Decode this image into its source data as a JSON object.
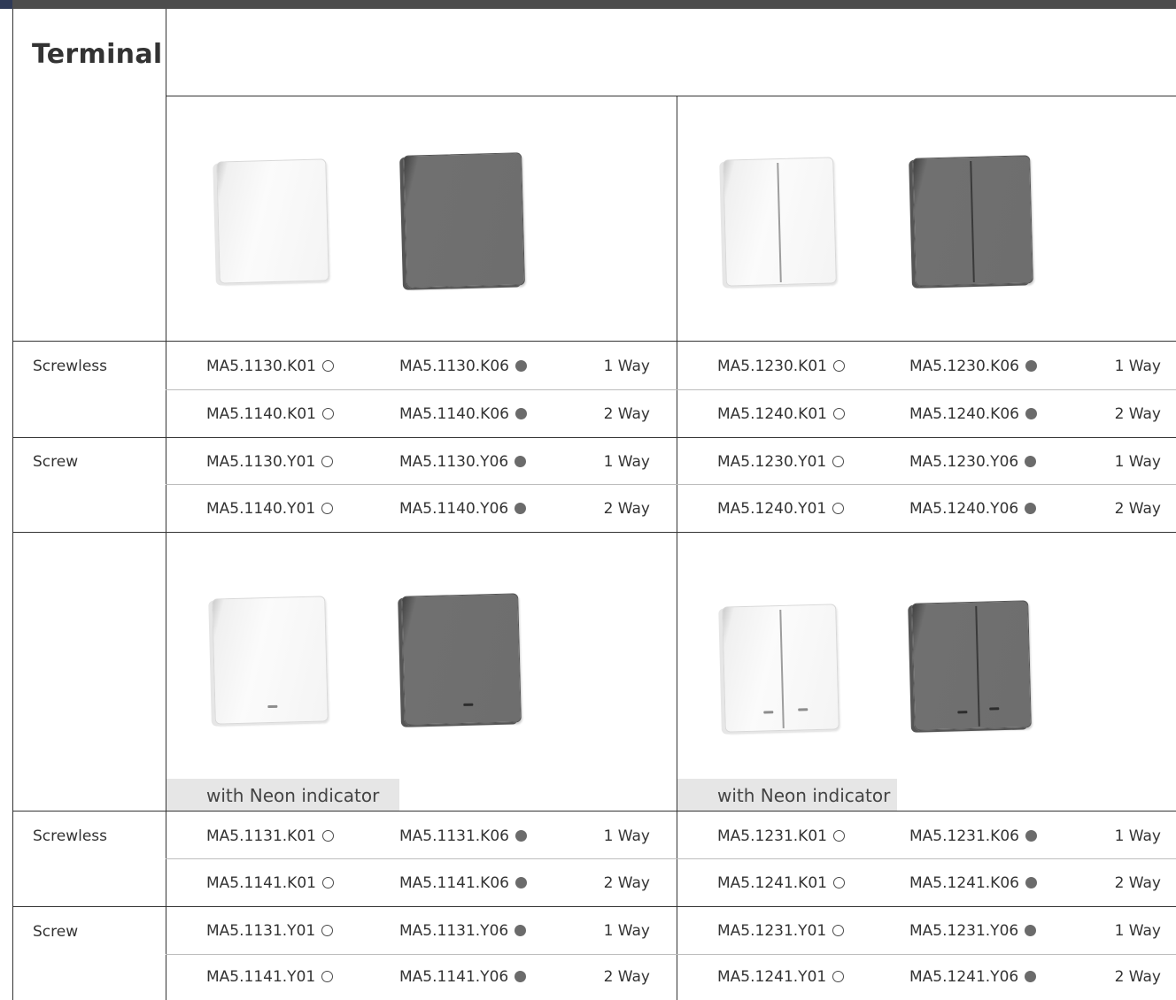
{
  "title": "Terminal",
  "neon_label": "with Neon indicator",
  "mount": {
    "screwless": "Screwless",
    "screw": "Screw"
  },
  "colors": {
    "white_dot": "hollow",
    "dark_dot": "#6b6b6b",
    "rule": "#333333"
  },
  "section1": {
    "left": [
      [
        "MA5.1130.K01",
        "MA5.1130.K06",
        "1 Way"
      ],
      [
        "MA5.1140.K01",
        "MA5.1140.K06",
        "2 Way"
      ],
      [
        "MA5.1130.Y01",
        "MA5.1130.Y06",
        "1 Way"
      ],
      [
        "MA5.1140.Y01",
        "MA5.1140.Y06",
        "2 Way"
      ]
    ],
    "right": [
      [
        "MA5.1230.K01",
        "MA5.1230.K06",
        "1 Way"
      ],
      [
        "MA5.1240.K01",
        "MA5.1240.K06",
        "2 Way"
      ],
      [
        "MA5.1230.Y01",
        "MA5.1230.Y06",
        "1 Way"
      ],
      [
        "MA5.1240.Y01",
        "MA5.1240.Y06",
        "2 Way"
      ]
    ]
  },
  "section2": {
    "left": [
      [
        "MA5.1131.K01",
        "MA5.1131.K06",
        "1 Way"
      ],
      [
        "MA5.1141.K01",
        "MA5.1141.K06",
        "2 Way"
      ],
      [
        "MA5.1131.Y01",
        "MA5.1131.Y06",
        "1 Way"
      ],
      [
        "MA5.1141.Y01",
        "MA5.1141.Y06",
        "2 Way"
      ]
    ],
    "right": [
      [
        "MA5.1231.K01",
        "MA5.1231.K06",
        "1 Way"
      ],
      [
        "MA5.1241.K01",
        "MA5.1241.K06",
        "2 Way"
      ],
      [
        "MA5.1231.Y01",
        "MA5.1231.Y06",
        "1 Way"
      ],
      [
        "MA5.1241.Y01",
        "MA5.1241.Y06",
        "2 Way"
      ]
    ]
  }
}
